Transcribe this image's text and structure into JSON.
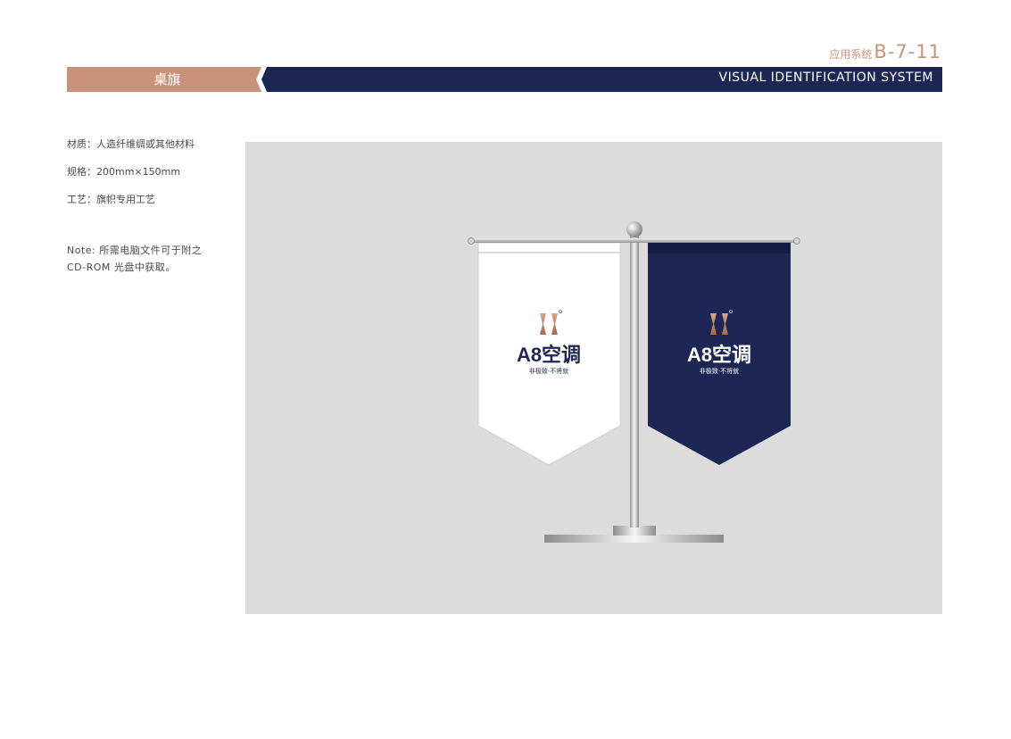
{
  "header": {
    "category_prefix": "应用系统",
    "section_code": "B-7-11",
    "tab_title": "桌旗",
    "system_title": "VISUAL IDENTIFICATION SYSTEM"
  },
  "specs": {
    "material": "材质：人造纤维绸或其他材料",
    "size": "规格：200mm×150mm",
    "craft": "工艺：旗帜专用工艺",
    "note_line1": "Note: 所需电脑文件可于附之",
    "note_line2": "CD-ROM 光盘中获取。"
  },
  "flags": {
    "left": {
      "brand": "A8空调",
      "slogan": "非极致·不将就",
      "background": "#ffffff",
      "text_color": "#1d2654"
    },
    "right": {
      "brand": "A8空调",
      "slogan": "非极致·不将就",
      "background": "#1d2654",
      "text_color": "#ffffff"
    }
  },
  "colors": {
    "accent_copper": "#c8937a",
    "navy": "#1d2654",
    "panel_gray": "#dcdcdc"
  }
}
